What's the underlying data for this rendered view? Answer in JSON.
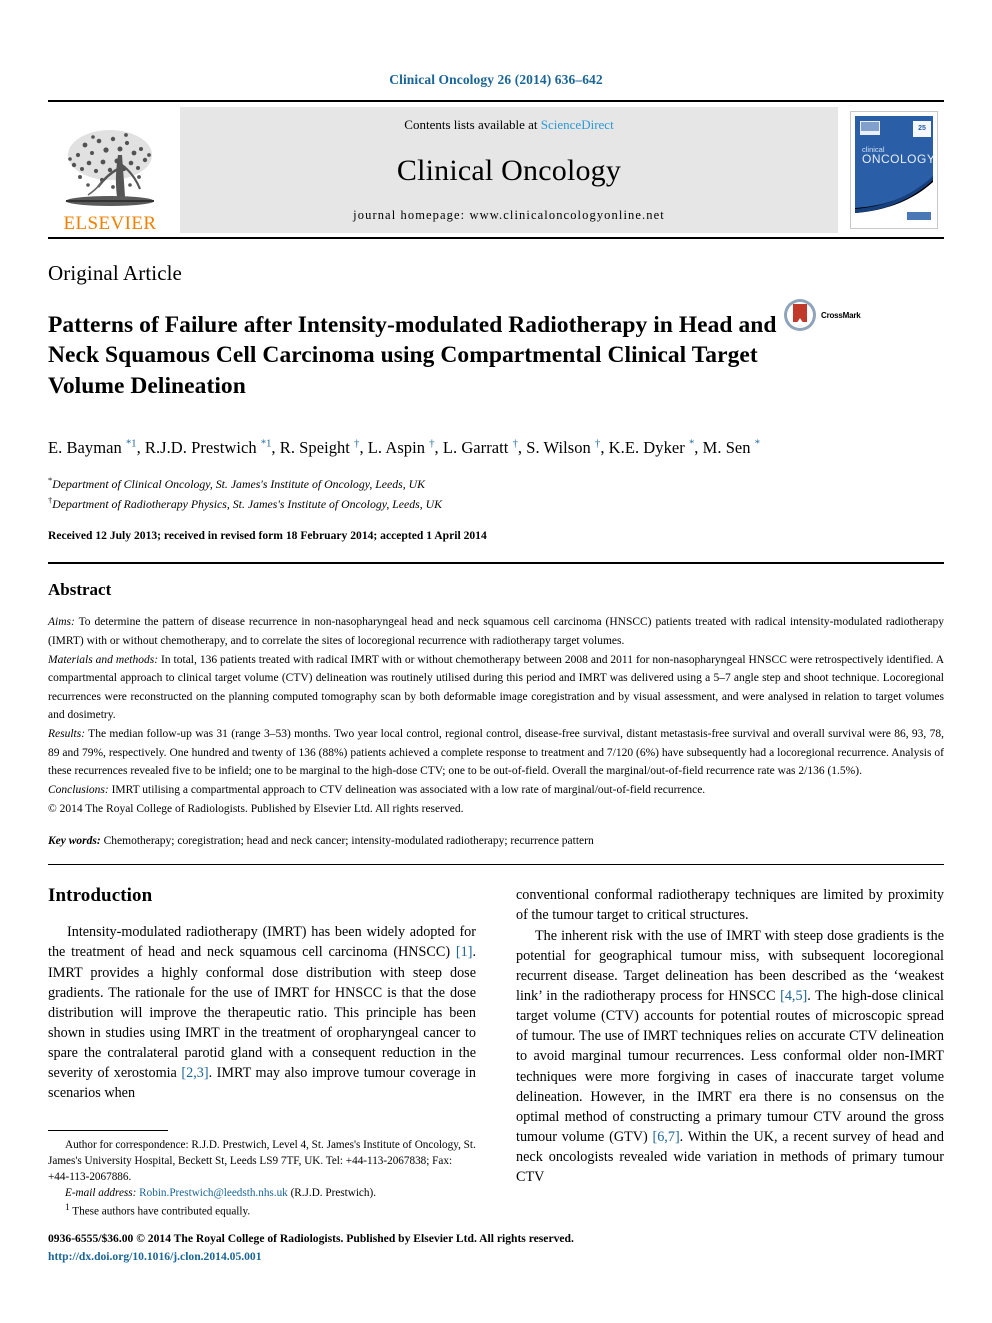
{
  "running_head": "Clinical Oncology 26 (2014) 636–642",
  "masthead": {
    "publisher_logo_label": "ELSEVIER",
    "contents_prefix": "Contents lists available at",
    "contents_link": "ScienceDirect",
    "journal_name": "Clinical Oncology",
    "homepage_line": "journal homepage: www.clinicaloncologyonline.net",
    "cover_title_small": "clinical",
    "cover_title_large": "ONCOLOGY",
    "cover_badge": "25"
  },
  "article": {
    "kicker": "Original Article",
    "title": "Patterns of Failure after Intensity-modulated Radiotherapy in Head and Neck Squamous Cell Carcinoma using Compartmental Clinical Target Volume Delineation",
    "crossmark_label": "CrossMark",
    "authors_line1": "E. Bayman",
    "authors_html": "E. Bayman <sup class=\"mark\">*1</sup>, R.J.D. Prestwich <sup class=\"mark\">*1</sup>, R. Speight <sup class=\"mark\">†</sup>, L. Aspin <sup class=\"mark\">†</sup>, L. Garratt <sup class=\"mark\">†</sup>, S. Wilson <sup class=\"mark\">†</sup>, K.E. Dyker <sup class=\"mark\">*</sup>, M. Sen <sup class=\"mark\">*</sup>",
    "affiliation_1": "Department of Clinical Oncology, St. James's Institute of Oncology, Leeds, UK",
    "affiliation_2": "Department of Radiotherapy Physics, St. James's Institute of Oncology, Leeds, UK",
    "affiliation_1_mark": "*",
    "affiliation_2_mark": "†",
    "history": "Received 12 July 2013; received in revised form 18 February 2014; accepted 1 April 2014"
  },
  "abstract": {
    "heading": "Abstract",
    "aims_label": "Aims:",
    "aims_text": " To determine the pattern of disease recurrence in non-nasopharyngeal head and neck squamous cell carcinoma (HNSCC) patients treated with radical intensity-modulated radiotherapy (IMRT) with or without chemotherapy, and to correlate the sites of locoregional recurrence with radiotherapy target volumes.",
    "methods_label": "Materials and methods:",
    "methods_text": " In total, 136 patients treated with radical IMRT with or without chemotherapy between 2008 and 2011 for non-nasopharyngeal HNSCC were retrospectively identified. A compartmental approach to clinical target volume (CTV) delineation was routinely utilised during this period and IMRT was delivered using a 5–7 angle step and shoot technique. Locoregional recurrences were reconstructed on the planning computed tomography scan by both deformable image coregistration and by visual assessment, and were analysed in relation to target volumes and dosimetry.",
    "results_label": "Results:",
    "results_text": " The median follow-up was 31 (range 3–53) months. Two year local control, regional control, disease-free survival, distant metastasis-free survival and overall survival were 86, 93, 78, 89 and 79%, respectively. One hundred and twenty of 136 (88%) patients achieved a complete response to treatment and 7/120 (6%) have subsequently had a locoregional recurrence. Analysis of these recurrences revealed five to be infield; one to be marginal to the high-dose CTV; one to be out-of-field. Overall the marginal/out-of-field recurrence rate was 2/136 (1.5%).",
    "conclusions_label": "Conclusions:",
    "conclusions_text": " IMRT utilising a compartmental approach to CTV delineation was associated with a low rate of marginal/out-of-field recurrence.",
    "copyright": "© 2014 The Royal College of Radiologists. Published by Elsevier Ltd. All rights reserved.",
    "keywords_label": "Key words:",
    "keywords_text": " Chemotherapy; coregistration; head and neck cancer; intensity-modulated radiotherapy; recurrence pattern"
  },
  "introduction": {
    "heading": "Introduction",
    "para1_a": "Intensity-modulated radiotherapy (IMRT) has been widely adopted for the treatment of head and neck squamous cell carcinoma (HNSCC) ",
    "para1_cite1": "[1]",
    "para1_b": ". IMRT provides a highly conformal dose distribution with steep dose gradients. The rationale for the use of IMRT for HNSCC is that the dose distribution will improve the therapeutic ratio. This principle has been shown in studies using IMRT in the treatment of oropharyngeal cancer to spare the contralateral parotid gland with a consequent reduction in the severity of xerostomia ",
    "para1_cite2": "[2,3]",
    "para1_c": ". IMRT may also improve tumour coverage in scenarios when conventional conformal radiotherapy techniques are limited by proximity of the tumour target to critical structures.",
    "para2_a": "The inherent risk with the use of IMRT with steep dose gradients is the potential for geographical tumour miss, with subsequent locoregional recurrent disease. Target delineation has been described as the ‘weakest link’ in the radiotherapy process for HNSCC ",
    "para2_cite1": "[4,5]",
    "para2_b": ". The high-dose clinical target volume (CTV) accounts for potential routes of microscopic spread of tumour. The use of IMRT techniques relies on accurate CTV delineation to avoid marginal tumour recurrences. Less conformal older non-IMRT techniques were more forgiving in cases of inaccurate target volume delineation. However, in the IMRT era there is no consensus on the optimal method of constructing a primary tumour CTV around the gross tumour volume (GTV) ",
    "para2_cite2": "[6,7]",
    "para2_c": ". Within the UK, a recent survey of head and neck oncologists revealed wide variation in methods of primary tumour CTV"
  },
  "footnote": {
    "correspondence": "Author for correspondence: R.J.D. Prestwich, Level 4, St. James's Institute of Oncology, St. James's University Hospital, Beckett St, Leeds LS9 7TF, UK. Tel: +44-113-2067838; Fax: +44-113-2067886.",
    "email_label": "E-mail address:",
    "email_link": "Robin.Prestwich@leedsth.nhs.uk",
    "email_suffix": " (R.J.D. Prestwich).",
    "equal_contrib_mark": "1",
    "equal_contrib": "These authors have contributed equally."
  },
  "page_footer": {
    "issn_line": "0936-6555/$36.00 © 2014 The Royal College of Radiologists. Published by Elsevier Ltd. All rights reserved.",
    "doi": "http://dx.doi.org/10.1016/j.clon.2014.05.001"
  },
  "colors": {
    "link_blue": "#1a6496",
    "sciencedirect_blue": "#2b9ad6",
    "elsevier_orange": "#f08000",
    "cover_blue": "#2a5fa8"
  }
}
